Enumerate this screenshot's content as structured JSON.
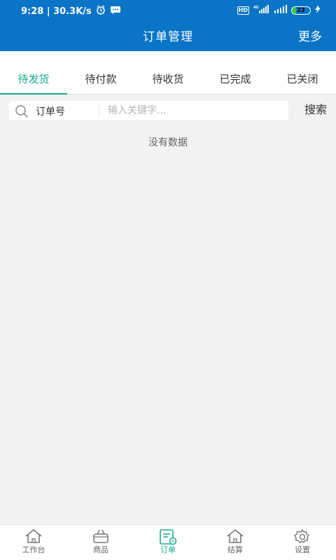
{
  "status_bar": {
    "time_speed": "9:28 | 30.3K/s",
    "hd_badge": "HD",
    "signal_label": "4G",
    "battery_level": "23",
    "battery_fraction": 0.23
  },
  "header": {
    "title": "订单管理",
    "more_label": "更多"
  },
  "tabs": [
    {
      "label": "待发货",
      "active": true
    },
    {
      "label": "待付款",
      "active": false
    },
    {
      "label": "待收货",
      "active": false
    },
    {
      "label": "已完成",
      "active": false
    },
    {
      "label": "已关闭",
      "active": false
    }
  ],
  "search": {
    "field_label": "订单号",
    "placeholder": "输入关键字...",
    "value": "",
    "button_label": "搜索"
  },
  "empty_state": "没有数据",
  "bottom_nav": [
    {
      "label": "工作台",
      "icon": "home-icon",
      "active": false
    },
    {
      "label": "商品",
      "icon": "basket-icon",
      "active": false
    },
    {
      "label": "订单",
      "icon": "order-icon",
      "active": true
    },
    {
      "label": "结算",
      "icon": "house-icon",
      "active": false
    },
    {
      "label": "设置",
      "icon": "gear-icon",
      "active": false
    }
  ],
  "colors": {
    "header_bg": "#0a74c6",
    "accent": "#1aa98e",
    "page_bg": "#f2f2f2"
  }
}
